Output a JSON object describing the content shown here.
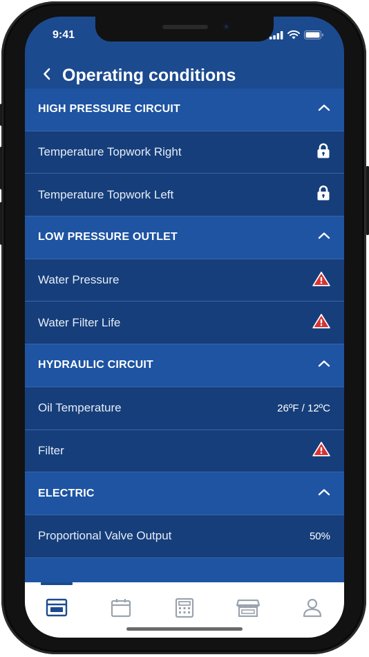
{
  "status_bar": {
    "time": "9:41"
  },
  "header": {
    "back_icon": "chevron-left-icon",
    "title": "Operating conditions"
  },
  "sections": [
    {
      "title": "HIGH PRESSURE CIRCUIT",
      "toggle_icon": "chevron-up-icon",
      "items": [
        {
          "label": "Temperature Topwork Right",
          "icon": "lock-icon"
        },
        {
          "label": "Temperature Topwork Left",
          "icon": "lock-icon"
        }
      ]
    },
    {
      "title": "LOW PRESSURE OUTLET",
      "toggle_icon": "chevron-up-icon",
      "items": [
        {
          "label": "Water Pressure",
          "icon": "warning-icon"
        },
        {
          "label": "Water Filter Life",
          "icon": "warning-icon"
        }
      ]
    },
    {
      "title": "HYDRAULIC CIRCUIT",
      "toggle_icon": "chevron-up-icon",
      "items": [
        {
          "label": "Oil Temperature",
          "value": "26ºF / 12ºC"
        },
        {
          "label": "Filter",
          "icon": "warning-icon"
        }
      ]
    },
    {
      "title": "ELECTRIC",
      "toggle_icon": "chevron-up-icon",
      "items": [
        {
          "label": "Proportional Valve Output",
          "value": "50%"
        }
      ]
    }
  ],
  "tab_bar": {
    "tabs": [
      {
        "icon": "dashboard-icon",
        "active": true
      },
      {
        "icon": "calendar-icon",
        "active": false
      },
      {
        "icon": "calculator-icon",
        "active": false
      },
      {
        "icon": "store-icon",
        "active": false
      },
      {
        "icon": "profile-icon",
        "active": false
      }
    ]
  },
  "colors": {
    "background": "#1c4a8f",
    "section_header": "#1e54a2",
    "item_row": "#163e7b",
    "warning": "#d63333",
    "tab_active": "#1c4a8f",
    "tab_inactive": "#9aa3ad"
  }
}
